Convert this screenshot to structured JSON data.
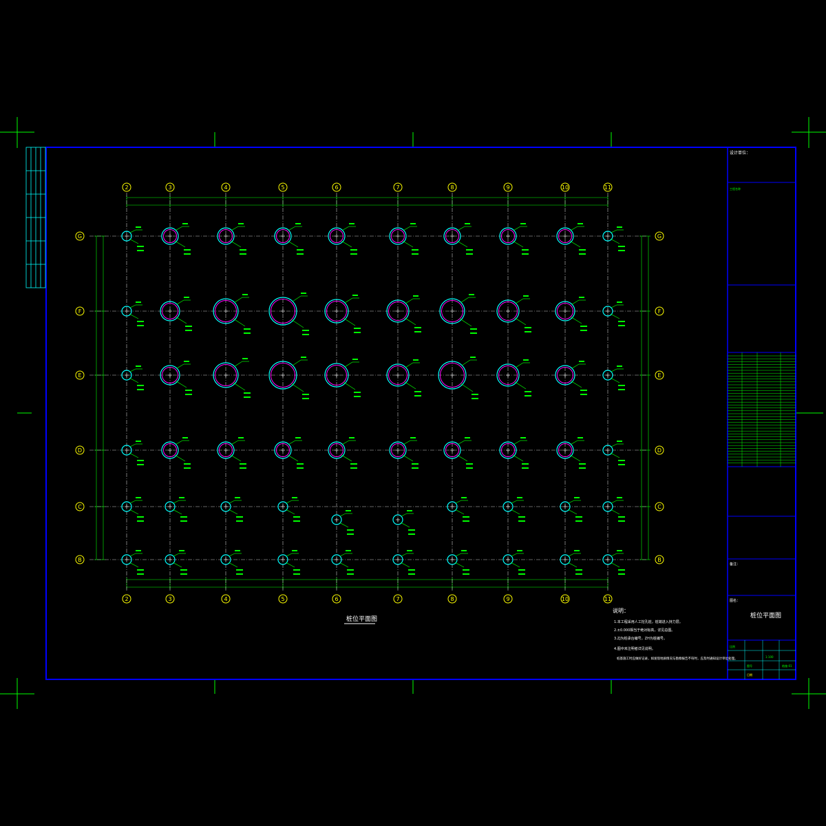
{
  "colors": {
    "background": "#000000",
    "frame": "#0000ff",
    "grid_line": "#c8c8c8",
    "axis_bubble": "#ffff00",
    "pile_outer": "#00ffff",
    "pile_inner": "#ff00ff",
    "annotation": "#00ff00",
    "title_text": "#ffffff",
    "table_line": "#00ff00"
  },
  "grid_axes": {
    "columns": [
      "2",
      "3",
      "4",
      "5",
      "6",
      "7",
      "8",
      "9",
      "10",
      "11"
    ],
    "rows": [
      "G",
      "F",
      "E",
      "D",
      "C",
      "B"
    ]
  },
  "drawing_title": "桩位平面图",
  "notes": {
    "heading": "说明：",
    "items": [
      "1.本工程采用人工挖孔桩，桩端进入持力层。",
      "2.±0.000相当于绝对标高，详见总图。",
      "3.ZJ为桩承台编号，ZH为桩编号。",
      "4.图中未注明者详见说明。"
    ],
    "extra": "桩基施工时应做好记录，如发现地质情况与勘察报告不符时，应及时通知设计单位处理。"
  },
  "title_block": {
    "designer_label": "设计单位：",
    "project_label": "工程名称",
    "remarks_label": "备注：",
    "drawing_name_label": "图名：",
    "drawing_name": "桩位平面图",
    "scale_label": "比例",
    "scale_value": "1:100",
    "sheet_label": "图号",
    "sheet_value": "结施-01",
    "date_label": "日期"
  }
}
